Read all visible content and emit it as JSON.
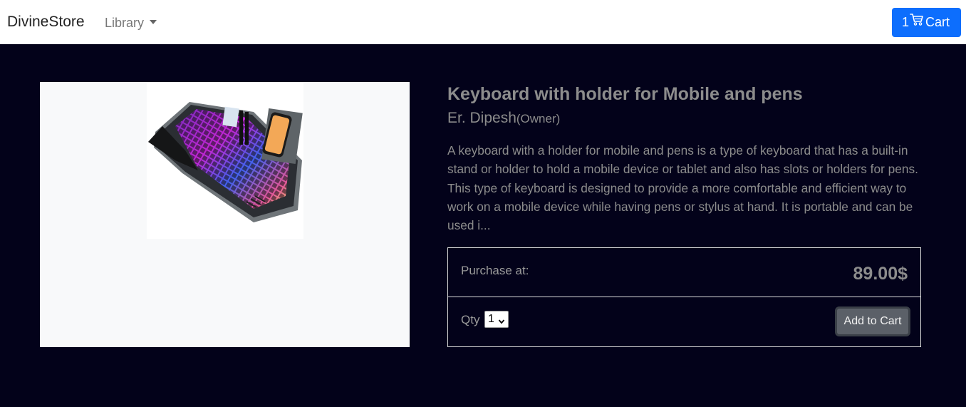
{
  "navbar": {
    "brand": "DivineStore",
    "library_label": "Library",
    "cart_count": "1",
    "cart_label": "Cart"
  },
  "product": {
    "image_alt": "keyboard-product-image",
    "title": "Keyboard with holder for Mobile and pens",
    "author": "Er. Dipesh",
    "author_role": "(Owner)",
    "description": "A keyboard with a holder for mobile and pens is a type of keyboard that has a built-in stand or holder to hold a mobile device or tablet and also has slots or holders for pens. This type of keyboard is designed to provide a more comfortable and efficient way to work on a mobile device while having pens or stylus at hand. It is portable and can be used i..."
  },
  "purchase": {
    "label": "Purchase at:",
    "price": "89.00$",
    "qty_label": "Qty",
    "qty_value": "1",
    "add_button": "Add to Cart"
  },
  "colors": {
    "page_bg": "#03021a",
    "primary": "#0d6efd",
    "text_muted": "#8c8c8c",
    "button_gray": "#5b6068"
  }
}
